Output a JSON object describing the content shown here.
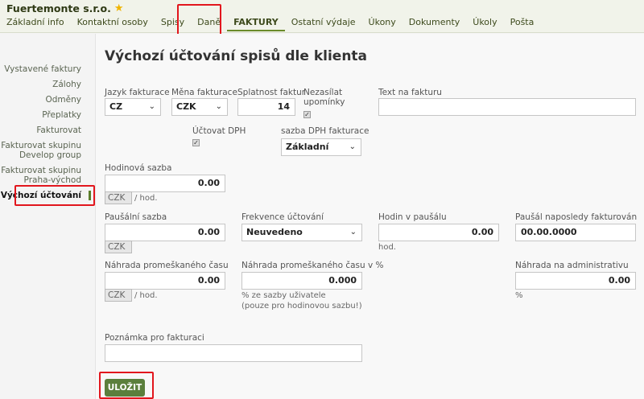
{
  "header": {
    "company": "Fuertemonte s.r.o.",
    "nav": [
      "Základní info",
      "Kontaktní osoby",
      "Spisy",
      "Daně",
      "FAKTURY",
      "Ostatní výdaje",
      "Úkony",
      "Dokumenty",
      "Úkoly",
      "Pošta"
    ],
    "active_nav": "FAKTURY"
  },
  "sidebar": {
    "items": [
      "Vystavené faktury",
      "Zálohy",
      "Odměny",
      "Přeplatky",
      "Fakturovat",
      "Fakturovat skupinu Develop group",
      "Fakturovat skupinu Praha-východ",
      "Výchozí účtování"
    ],
    "active": "Výchozí účtování"
  },
  "page": {
    "title": "Výchozí účtování spisů dle klienta"
  },
  "form": {
    "jazyk_label": "Jazyk fakturace",
    "jazyk_value": "CZ",
    "mena_label": "Měna fakturace",
    "mena_value": "CZK",
    "splatnost_label": "Splatnost faktur",
    "splatnost_value": "14",
    "nezasilat_label_1": "Nezasílat",
    "nezasilat_label_2": "upomínky",
    "nezasilat_checked": true,
    "text_label": "Text na fakturu",
    "text_value": "",
    "uctovat_dph_label": "Účtovat DPH",
    "uctovat_dph_checked": true,
    "sazba_dph_label": "sazba DPH fakturace",
    "sazba_dph_value": "Základní",
    "hodinova_label": "Hodinová sazba",
    "hodinova_value": "0.00",
    "hodinova_currency": "CZK",
    "hodinova_unit": "/ hod.",
    "pausalni_label": "Paušální sazba",
    "pausalni_value": "0.00",
    "pausalni_currency": "CZK",
    "frekvence_label": "Frekvence účtování",
    "frekvence_value": "Neuvedeno",
    "hodin_label": "Hodin v paušálu",
    "hodin_value": "0.00",
    "hodin_unit": "hod.",
    "pausal_naposledy_label": "Paušál naposledy fakturován",
    "pausal_naposledy_value": "00.00.0000",
    "nahrada_label": "Náhrada promeškaného času",
    "nahrada_value": "0.00",
    "nahrada_currency": "CZK",
    "nahrada_unit": "/ hod.",
    "nahrada_pct_label": "Náhrada promeškaného času v %",
    "nahrada_pct_value": "0.000",
    "nahrada_pct_hint_1": "% ze sazby uživatele",
    "nahrada_pct_hint_2": "(pouze pro hodinovou sazbu!)",
    "nahrada_admin_label": "Náhrada na administrativu",
    "nahrada_admin_value": "0.00",
    "nahrada_admin_unit": "%",
    "poznamka_label": "Poznámka pro fakturaci",
    "poznamka_value": ""
  },
  "actions": {
    "save_label": "ULOŽIT"
  },
  "colors": {
    "accent": "#5b7f3c",
    "highlight": "#e2161d",
    "header_bg": "#f1f3ea"
  }
}
